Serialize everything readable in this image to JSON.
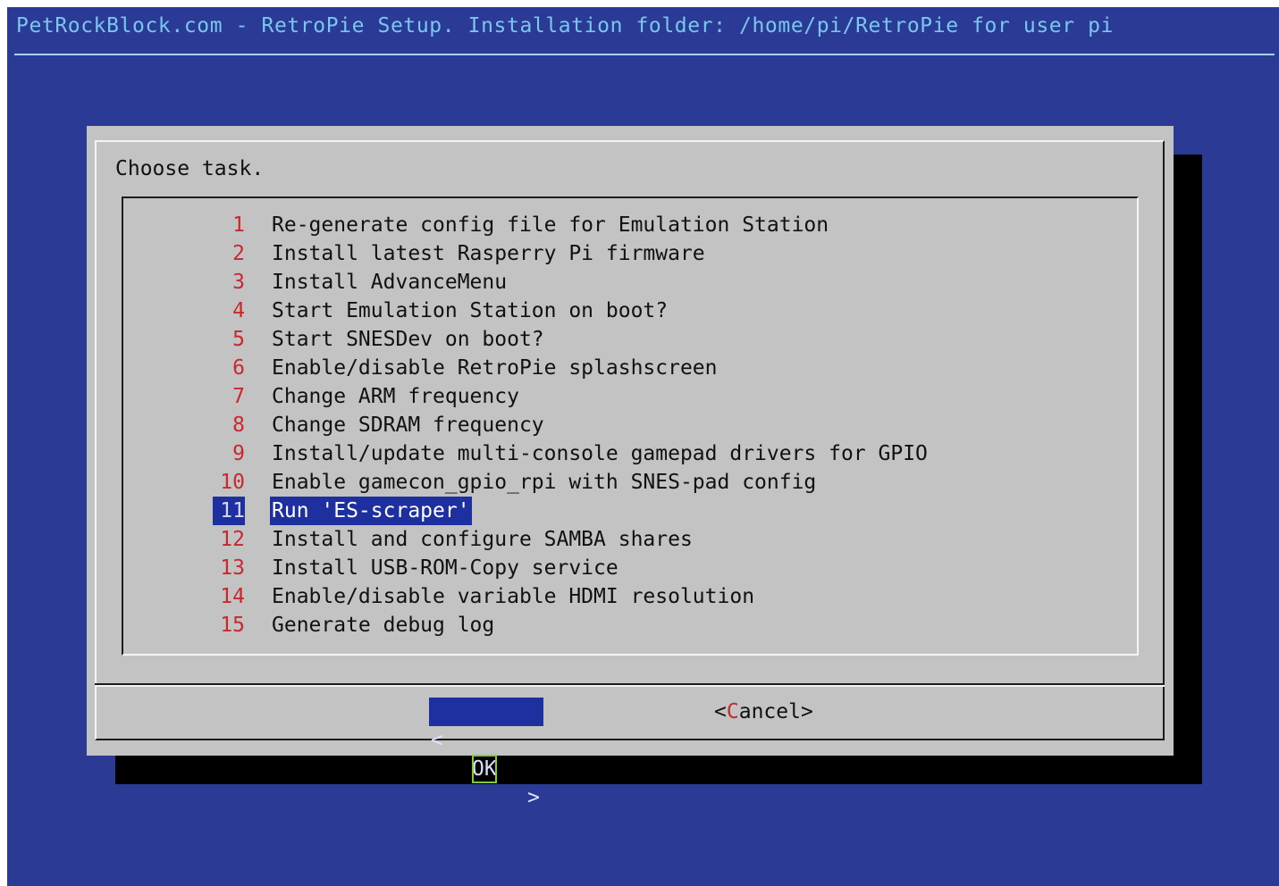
{
  "backtitle": "PetRockBlock.com - RetroPie Setup. Installation folder: /home/pi/RetroPie for user pi",
  "dialog": {
    "prompt": "Choose task.",
    "items": [
      {
        "num": "1",
        "label": "Re-generate config file for Emulation Station"
      },
      {
        "num": "2",
        "label": "Install latest Rasperry Pi firmware"
      },
      {
        "num": "3",
        "label": "Install AdvanceMenu"
      },
      {
        "num": "4",
        "label": "Start Emulation Station on boot?"
      },
      {
        "num": "5",
        "label": "Start SNESDev on boot?"
      },
      {
        "num": "6",
        "label": "Enable/disable RetroPie splashscreen"
      },
      {
        "num": "7",
        "label": "Change ARM frequency"
      },
      {
        "num": "8",
        "label": "Change SDRAM frequency"
      },
      {
        "num": "9",
        "label": "Install/update multi-console gamepad drivers for GPIO"
      },
      {
        "num": "10",
        "label": "Enable gamecon_gpio_rpi with SNES-pad config"
      },
      {
        "num": "11",
        "label": "Run 'ES-scraper'"
      },
      {
        "num": "12",
        "label": "Install and configure SAMBA shares"
      },
      {
        "num": "13",
        "label": "Install USB-ROM-Copy service"
      },
      {
        "num": "14",
        "label": "Enable/disable variable HDMI resolution"
      },
      {
        "num": "15",
        "label": "Generate debug log"
      }
    ],
    "selected_num": "11",
    "ok_button": {
      "left": "<",
      "label": "OK",
      "right": ">"
    },
    "cancel_button": {
      "open": "<",
      "hotkey": "C",
      "rest": "ancel",
      "close": ">"
    }
  },
  "colors": {
    "screen_bg": "#2b3a94",
    "dialog_bg": "#c3c3c3",
    "item_number": "#c8282e",
    "selection": "#1e2fa0",
    "backtitle": "#79c6ee"
  }
}
